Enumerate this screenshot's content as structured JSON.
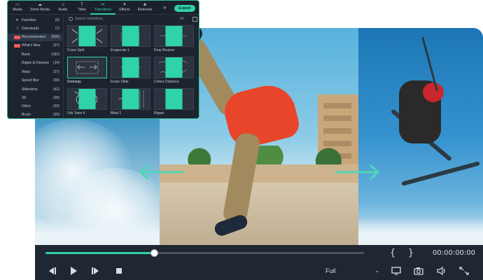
{
  "editor": {
    "tabs": [
      {
        "label": "Media",
        "icon": "folder-icon"
      },
      {
        "label": "Stock Media",
        "icon": "cloud-icon"
      },
      {
        "label": "Audio",
        "icon": "music-icon"
      },
      {
        "label": "Titles",
        "icon": "text-icon"
      },
      {
        "label": "Transitions",
        "icon": "transitions-icon"
      },
      {
        "label": "Effects",
        "icon": "sparkle-icon"
      },
      {
        "label": "Elements",
        "icon": "elements-icon"
      }
    ],
    "more": "»",
    "export_label": "Export",
    "sidebar": [
      {
        "label": "Favorites",
        "count": "(0)",
        "icon": "heart-icon"
      },
      {
        "label": "Downloads",
        "count": "(7)",
        "icon": "download-icon"
      },
      {
        "label": "Recommended",
        "count": "(500)",
        "badge": "HOT"
      },
      {
        "label": "What's New",
        "count": "(37)",
        "badge": "NEW"
      },
      {
        "label": "Basic",
        "count": "(181)"
      },
      {
        "label": "Ripple & Dissolve",
        "count": "(14)"
      },
      {
        "label": "Warp",
        "count": "(37)"
      },
      {
        "label": "Speed Blur",
        "count": "(30)"
      },
      {
        "label": "Slideshow",
        "count": "(42)"
      },
      {
        "label": "3D",
        "count": "(26)"
      },
      {
        "label": "Glitch",
        "count": "(23)"
      },
      {
        "label": "Brush",
        "count": "(25)"
      }
    ],
    "search_placeholder": "Search transitions",
    "filter_label": "All",
    "thumbnails": [
      {
        "label": "Cross Split"
      },
      {
        "label": "Evaporate 1"
      },
      {
        "label": "Drop Bounce"
      },
      {
        "label": "Doorway"
      },
      {
        "label": "Erase Slide"
      },
      {
        "label": "Colour Distance"
      },
      {
        "label": "Orb Twist 4"
      },
      {
        "label": "Blind 1"
      },
      {
        "label": "Ripper"
      }
    ]
  },
  "player": {
    "progress": 0.34,
    "mark_in": "{",
    "mark_out": "}",
    "timecode": "00:00:00:00",
    "quality": "Full",
    "accent": "#2ed3a9"
  }
}
